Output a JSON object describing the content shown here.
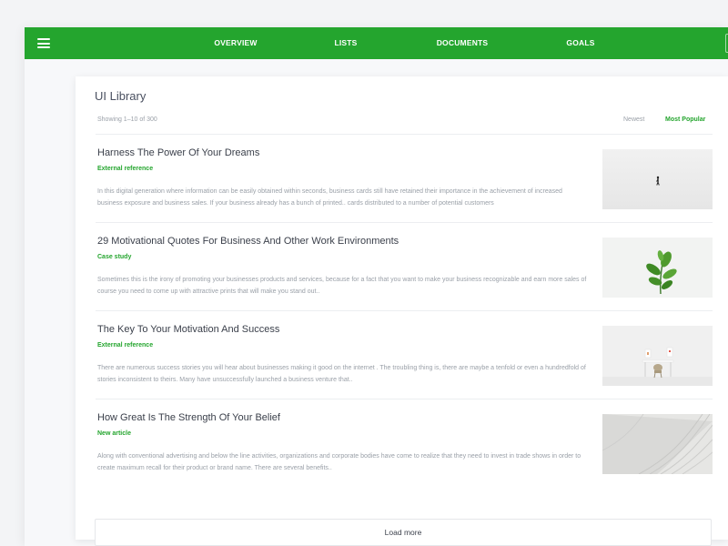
{
  "nav": {
    "items": [
      {
        "label": "OVERVIEW"
      },
      {
        "label": "LISTS"
      },
      {
        "label": "DOCUMENTS"
      },
      {
        "label": "GOALS"
      }
    ]
  },
  "colors": {
    "accent": "#24a52e",
    "text": "#3a3f4a",
    "muted": "#9aa0a8"
  },
  "library": {
    "title": "UI Library",
    "showing": "Showing 1–10 of 300",
    "sort": {
      "newest": "Newest",
      "popular": "Most Popular",
      "active": "Most Popular"
    },
    "articles": [
      {
        "title": "Harness The Power Of Your Dreams",
        "tag": "External reference",
        "description": "In this digital generation where information can be easily obtained within seconds, business cards still have retained their importance in the achievement of increased business exposure and business sales. If your business already has a bunch of printed.. cards distributed to a number of potential customers",
        "image": "person-walking-in-snow"
      },
      {
        "title": "29 Motivational Quotes For Business And Other Work Environments",
        "tag": "Case study",
        "description": "Sometimes this is the irony of promoting your businesses products and services, because for a fact that you want to make your business recognizable and earn more sales of course you need to come up with attractive prints that will make you stand out..",
        "image": "green-plant"
      },
      {
        "title": "The Key To Your Motivation And Success",
        "tag": "External reference",
        "description": "There are numerous success stories you will hear about businesses making it good on the internet . The troubling thing is, there are maybe a tenfold or even a hundredfold of stories inconsistent to theirs. Many have unsuccessfully launched a business venture that..",
        "image": "minimal-desk-and-chair"
      },
      {
        "title": "How Great Is The Strength Of Your Belief",
        "tag": "New article",
        "description": "Along with conventional advertising and below the line activities, organizations and corporate bodies have come to realize that they need to invest in trade shows in order to create maximum recall for their product or brand name. There are several benefits..",
        "image": "curved-stone-steps"
      }
    ],
    "load_more": "Load more"
  }
}
